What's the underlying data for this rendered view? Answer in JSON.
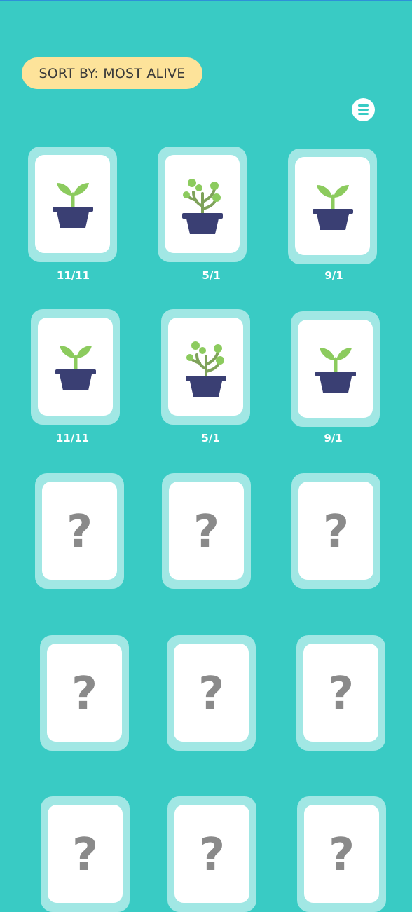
{
  "header": {
    "sort_label": "SORT BY: MOST ALIVE",
    "menu_icon": "hamburger-menu-icon"
  },
  "colors": {
    "background": "#39CBC4",
    "card_frame": "#A1E7E4",
    "card_face": "#FFFFFF",
    "sort_pill": "#FDE39A",
    "pot": "#3A3F73",
    "leaf": "#8CCB5E",
    "question_mark": "#8A8A8A"
  },
  "plants": [
    {
      "date": "11/11",
      "icon": "seedling-icon"
    },
    {
      "date": "5/1",
      "icon": "sprout-plant-icon"
    },
    {
      "date": "9/1",
      "icon": "seedling-icon"
    },
    {
      "date": "11/11",
      "icon": "seedling-icon"
    },
    {
      "date": "5/1",
      "icon": "sprout-plant-icon"
    },
    {
      "date": "9/1",
      "icon": "seedling-icon"
    }
  ],
  "locked_cards": [
    {
      "symbol": "?"
    },
    {
      "symbol": "?"
    },
    {
      "symbol": "?"
    },
    {
      "symbol": "?"
    },
    {
      "symbol": "?"
    },
    {
      "symbol": "?"
    },
    {
      "symbol": "?"
    },
    {
      "symbol": "?"
    },
    {
      "symbol": "?"
    }
  ]
}
